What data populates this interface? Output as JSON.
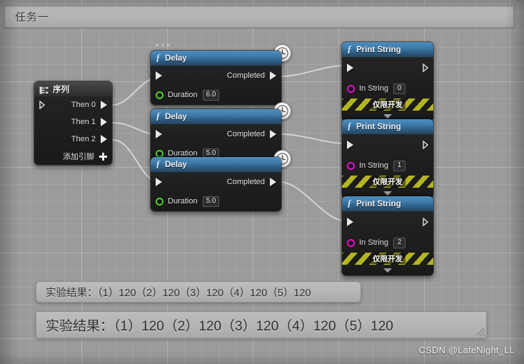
{
  "window": {
    "title": "任务一"
  },
  "graph": {
    "ellipsis_marker": "node-collapsed-marker",
    "sequence_node": {
      "title": "序列",
      "icon": "sequence-icon",
      "exec_in": "exec-in-pin",
      "outputs": [
        {
          "label": "Then 0"
        },
        {
          "label": "Then 1"
        },
        {
          "label": "Then 2"
        }
      ],
      "add_pin_label": "添加引脚",
      "add_pin_icon": "plus-icon"
    },
    "delay_nodes": [
      {
        "title": "Delay",
        "icon": "function-f-icon",
        "badge": "clock-icon",
        "output_label": "Completed",
        "duration_label": "Duration",
        "duration_value": "6.0"
      },
      {
        "title": "Delay",
        "icon": "function-f-icon",
        "badge": "clock-icon",
        "output_label": "Completed",
        "duration_label": "Duration",
        "duration_value": "5.0"
      },
      {
        "title": "Delay",
        "icon": "function-f-icon",
        "badge": "clock-icon",
        "output_label": "Completed",
        "duration_label": "Duration",
        "duration_value": "5.0"
      }
    ],
    "print_string_nodes": [
      {
        "title": "Print String",
        "icon": "function-f-icon",
        "in_string_label": "In String",
        "in_string_value": "0",
        "dev_only_label": "仅限开发",
        "collapse_icon": "triangle-down-icon"
      },
      {
        "title": "Print String",
        "icon": "function-f-icon",
        "in_string_label": "In String",
        "in_string_value": "1",
        "dev_only_label": "仅限开发",
        "collapse_icon": "triangle-down-icon"
      },
      {
        "title": "Print String",
        "icon": "function-f-icon",
        "in_string_label": "In String",
        "in_string_value": "2",
        "dev_only_label": "仅限开发",
        "collapse_icon": "triangle-down-icon"
      }
    ]
  },
  "results": [
    {
      "text": "实验结果：（1）120（2）120（3）120（4）120（5）120"
    },
    {
      "text": "实验结果：（1）120（2）120（3）120（4）120（5）120"
    }
  ],
  "watermark": {
    "text": "CSDN @LateNight_LL"
  },
  "colors": {
    "function_header": "#3e7aa9",
    "sequence_header": "#3c3c3c",
    "node_body": "#1d1e1d",
    "exec_pin": "#e8e8e8",
    "float_pin": "#53d22c",
    "string_pin": "#e310c9",
    "dev_band": "#b4b422",
    "wire": "#dedede",
    "graph_background": "#9b9b9b"
  }
}
